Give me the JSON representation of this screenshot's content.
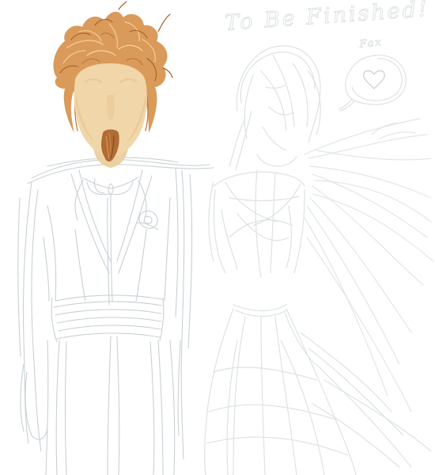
{
  "canvas": {
    "background": "#ffffff"
  },
  "caption": {
    "main": "To Be Finished!",
    "signature": "Fax"
  },
  "speech_bubble": {
    "icon": "heart-icon"
  },
  "colors": {
    "skin": "#f0d6a8",
    "skin_shadow": "#e2bc84",
    "hair": "#d99a5a",
    "hair_dark": "#a8622a",
    "hair_light": "#f3c58a",
    "groom_sketch": "#c9d0d3",
    "bride_sketch": "#dce3e1"
  }
}
